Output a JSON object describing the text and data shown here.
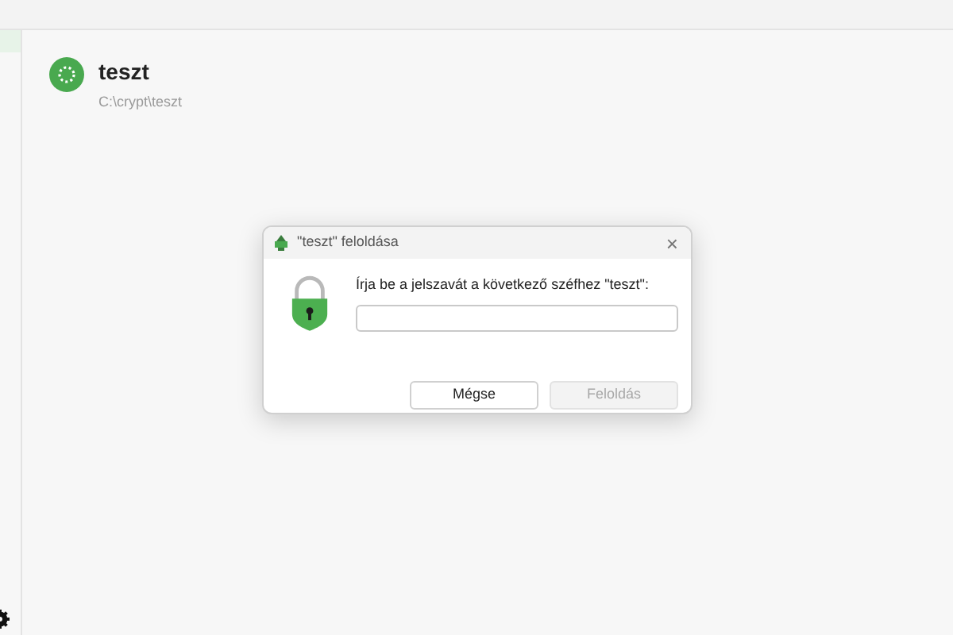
{
  "sidebar": {
    "selected_item": true
  },
  "vault": {
    "name": "teszt",
    "path": "C:\\crypt\\teszt"
  },
  "dialog": {
    "title": "\"teszt\" feloldása",
    "close": "×",
    "prompt": "Írja be a jelszavát a következő széfhez \"teszt\":",
    "buttons": [
      {
        "label": "Mégse",
        "disabled": false
      },
      {
        "label": "Feloldás",
        "disabled": true
      }
    ]
  }
}
